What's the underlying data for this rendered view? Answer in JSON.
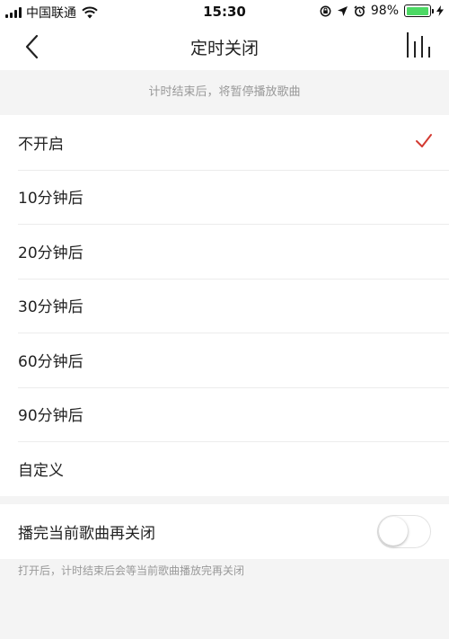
{
  "status_bar": {
    "carrier": "中国联通",
    "time": "15:30",
    "battery_text": "98%",
    "battery_level": 0.98,
    "battery_color": "#4cd964"
  },
  "nav": {
    "title": "定时关闭",
    "back_icon": "chevron-left-icon",
    "right_icon": "equalizer-icon"
  },
  "hint_top": "计时结束后，将暂停播放歌曲",
  "options": [
    {
      "label": "不开启",
      "selected": true
    },
    {
      "label": "10分钟后",
      "selected": false
    },
    {
      "label": "20分钟后",
      "selected": false
    },
    {
      "label": "30分钟后",
      "selected": false
    },
    {
      "label": "60分钟后",
      "selected": false
    },
    {
      "label": "90分钟后",
      "selected": false
    },
    {
      "label": "自定义",
      "selected": false
    }
  ],
  "check_color": "#d33a31",
  "toggle": {
    "label": "播完当前歌曲再关闭",
    "on": false
  },
  "hint_bottom": "打开后，计时结束后会等当前歌曲播放完再关闭"
}
